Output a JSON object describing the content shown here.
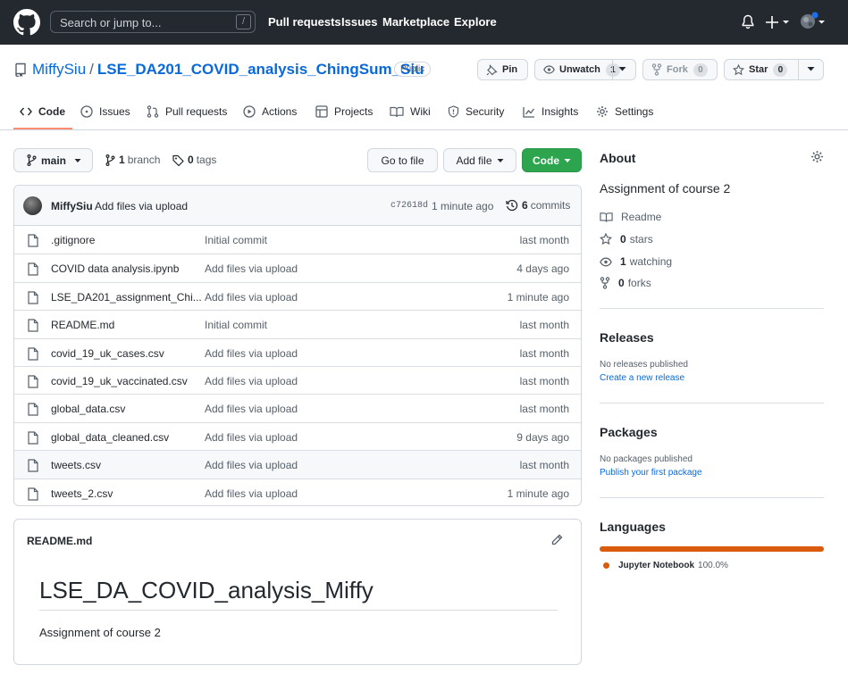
{
  "header": {
    "search_placeholder": "Search or jump to...",
    "search_shortcut": "/",
    "nav": [
      "Pull requests",
      "Issues",
      "Marketplace",
      "Explore"
    ]
  },
  "repo": {
    "owner": "MiffySiu",
    "separator": "/",
    "name": "LSE_DA201_COVID_analysis_ChingSum_Siu",
    "visibility": "Public",
    "pin_label": "Pin",
    "unwatch_label": "Unwatch",
    "watch_count": "1",
    "fork_label": "Fork",
    "fork_count": "0",
    "star_label": "Star",
    "star_count": "0"
  },
  "tabs": [
    {
      "label": "Code",
      "icon": "code-icon"
    },
    {
      "label": "Issues",
      "icon": "issue-icon"
    },
    {
      "label": "Pull requests",
      "icon": "pull-request-icon"
    },
    {
      "label": "Actions",
      "icon": "play-icon"
    },
    {
      "label": "Projects",
      "icon": "table-icon"
    },
    {
      "label": "Wiki",
      "icon": "book-icon"
    },
    {
      "label": "Security",
      "icon": "shield-icon"
    },
    {
      "label": "Insights",
      "icon": "graph-icon"
    },
    {
      "label": "Settings",
      "icon": "gear-icon"
    }
  ],
  "branch_bar": {
    "branch": "main",
    "branch_count": "1",
    "branch_label": "branch",
    "tag_count": "0",
    "tag_label": "tags",
    "go_to_file": "Go to file",
    "add_file": "Add file",
    "code": "Code"
  },
  "latest_commit": {
    "author": "MiffySiu",
    "message": "Add files via upload",
    "sha": "c72618d",
    "time": "1 minute ago",
    "commit_count": "6",
    "commit_label": "commits"
  },
  "files": [
    {
      "name": ".gitignore",
      "message": "Initial commit",
      "age": "last month"
    },
    {
      "name": "COVID data analysis.ipynb",
      "message": "Add files via upload",
      "age": "4 days ago"
    },
    {
      "name": "LSE_DA201_assignment_Chi...",
      "message": "Add files via upload",
      "age": "1 minute ago"
    },
    {
      "name": "README.md",
      "message": "Initial commit",
      "age": "last month"
    },
    {
      "name": "covid_19_uk_cases.csv",
      "message": "Add files via upload",
      "age": "last month"
    },
    {
      "name": "covid_19_uk_vaccinated.csv",
      "message": "Add files via upload",
      "age": "last month"
    },
    {
      "name": "global_data.csv",
      "message": "Add files via upload",
      "age": "last month"
    },
    {
      "name": "global_data_cleaned.csv",
      "message": "Add files via upload",
      "age": "9 days ago"
    },
    {
      "name": "tweets.csv",
      "message": "Add files via upload",
      "age": "last month"
    },
    {
      "name": "tweets_2.csv",
      "message": "Add files via upload",
      "age": "1 minute ago"
    }
  ],
  "readme": {
    "filename": "README.md",
    "heading": "LSE_DA_COVID_analysis_Miffy",
    "body": "Assignment of course 2"
  },
  "sidebar": {
    "about_title": "About",
    "description": "Assignment of course 2",
    "readme_label": "Readme",
    "stars_count": "0",
    "stars_label": "stars",
    "watching_count": "1",
    "watching_label": "watching",
    "forks_count": "0",
    "forks_label": "forks",
    "releases_title": "Releases",
    "releases_empty": "No releases published",
    "releases_link": "Create a new release",
    "packages_title": "Packages",
    "packages_empty": "No packages published",
    "packages_link": "Publish your first package",
    "languages_title": "Languages",
    "language_name": "Jupyter Notebook",
    "language_percent": "100.0%",
    "language_share": 1.0,
    "language_color": "#da5b0b"
  },
  "colors": {
    "header_bg": "#24292f",
    "link": "#0969da",
    "code_button": "#2da44e",
    "active_tab": "#fd8c73"
  }
}
